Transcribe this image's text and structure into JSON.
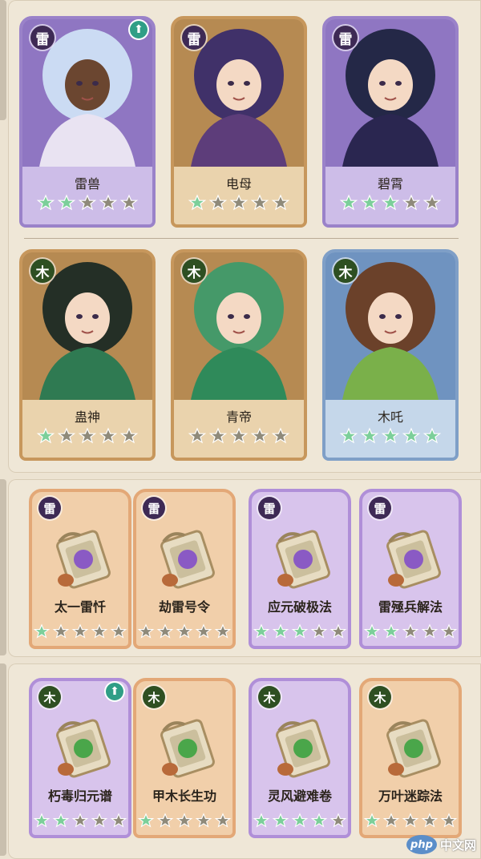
{
  "heroes": [
    {
      "name": "雷兽",
      "element": "雷",
      "theme": "purple",
      "stars_lit": 2,
      "upgrade": true,
      "upgrade_icon": "arrow-up-icon"
    },
    {
      "name": "电母",
      "element": "雷",
      "theme": "gold",
      "stars_lit": 1,
      "upgrade": false
    },
    {
      "name": "碧霄",
      "element": "雷",
      "theme": "purple",
      "stars_lit": 3,
      "upgrade": false
    },
    {
      "name": "蛊神",
      "element": "木",
      "theme": "gold",
      "stars_lit": 1,
      "upgrade": false
    },
    {
      "name": "青帝",
      "element": "木",
      "theme": "gold",
      "stars_lit": 0,
      "upgrade": false
    },
    {
      "name": "木吒",
      "element": "木",
      "theme": "blue",
      "stars_lit": 5,
      "upgrade": false
    }
  ],
  "skills_thunder": [
    {
      "name": "太一雷忏",
      "element": "雷",
      "theme": "orange",
      "stars_lit": 1
    },
    {
      "name": "劫雷号令",
      "element": "雷",
      "theme": "orange",
      "stars_lit": 0
    },
    {
      "name": "应元破极法",
      "element": "雷",
      "theme": "violet",
      "stars_lit": 3
    },
    {
      "name": "雷殛兵解法",
      "element": "雷",
      "theme": "violet",
      "stars_lit": 2
    }
  ],
  "skills_wood": [
    {
      "name": "朽毒归元谱",
      "element": "木",
      "theme": "violet",
      "stars_lit": 2,
      "upgrade": true,
      "upgrade_icon": "arrow-up-icon"
    },
    {
      "name": "甲木长生功",
      "element": "木",
      "theme": "orange",
      "stars_lit": 1
    },
    {
      "name": "灵风避难卷",
      "element": "木",
      "theme": "violet",
      "stars_lit": 4
    },
    {
      "name": "万叶迷踪法",
      "element": "木",
      "theme": "orange",
      "stars_lit": 1
    }
  ],
  "watermark": {
    "logo": "php",
    "text": "中文网"
  },
  "colors": {
    "star_lit": "#7ccf9a",
    "star_dim": "#8f8a7a",
    "thunder": "#3e2a55",
    "wood": "#2e4f22",
    "upgrade": "#2f9e86"
  }
}
